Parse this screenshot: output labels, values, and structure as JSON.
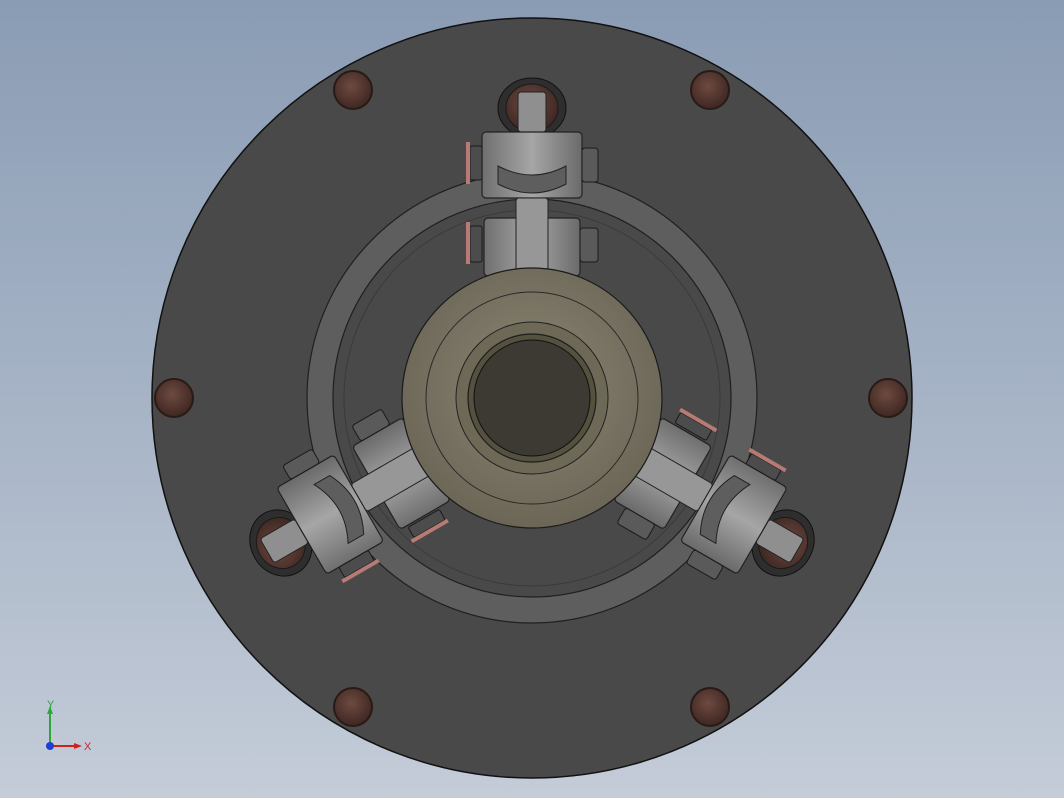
{
  "viewport": {
    "background_top": "#8a9cb4",
    "background_bottom": "#c4ccd8"
  },
  "model": {
    "flange_color": "#494949",
    "bolt_color": "#5a3a32",
    "ring_color": "#5c5c5c",
    "hub_color": "#7a7564",
    "bore_color": "#3c3a33",
    "arm_color": "#8d8d8d",
    "bolt_count": 6,
    "arm_count": 3
  },
  "triad": {
    "x_label": "X",
    "y_label": "Y",
    "x_color": "#d21f1f",
    "y_color": "#2aa83a",
    "z_color": "#1f3fd2"
  }
}
